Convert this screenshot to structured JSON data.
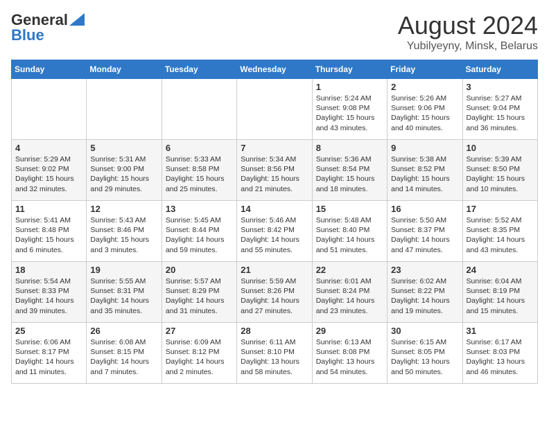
{
  "header": {
    "logo_general": "General",
    "logo_blue": "Blue",
    "title": "August 2024",
    "subtitle": "Yubilyeyny, Minsk, Belarus"
  },
  "days_of_week": [
    "Sunday",
    "Monday",
    "Tuesday",
    "Wednesday",
    "Thursday",
    "Friday",
    "Saturday"
  ],
  "weeks": [
    [
      {
        "day": "",
        "info": ""
      },
      {
        "day": "",
        "info": ""
      },
      {
        "day": "",
        "info": ""
      },
      {
        "day": "",
        "info": ""
      },
      {
        "day": "1",
        "info": "Sunrise: 5:24 AM\nSunset: 9:08 PM\nDaylight: 15 hours\nand 43 minutes."
      },
      {
        "day": "2",
        "info": "Sunrise: 5:26 AM\nSunset: 9:06 PM\nDaylight: 15 hours\nand 40 minutes."
      },
      {
        "day": "3",
        "info": "Sunrise: 5:27 AM\nSunset: 9:04 PM\nDaylight: 15 hours\nand 36 minutes."
      }
    ],
    [
      {
        "day": "4",
        "info": "Sunrise: 5:29 AM\nSunset: 9:02 PM\nDaylight: 15 hours\nand 32 minutes."
      },
      {
        "day": "5",
        "info": "Sunrise: 5:31 AM\nSunset: 9:00 PM\nDaylight: 15 hours\nand 29 minutes."
      },
      {
        "day": "6",
        "info": "Sunrise: 5:33 AM\nSunset: 8:58 PM\nDaylight: 15 hours\nand 25 minutes."
      },
      {
        "day": "7",
        "info": "Sunrise: 5:34 AM\nSunset: 8:56 PM\nDaylight: 15 hours\nand 21 minutes."
      },
      {
        "day": "8",
        "info": "Sunrise: 5:36 AM\nSunset: 8:54 PM\nDaylight: 15 hours\nand 18 minutes."
      },
      {
        "day": "9",
        "info": "Sunrise: 5:38 AM\nSunset: 8:52 PM\nDaylight: 15 hours\nand 14 minutes."
      },
      {
        "day": "10",
        "info": "Sunrise: 5:39 AM\nSunset: 8:50 PM\nDaylight: 15 hours\nand 10 minutes."
      }
    ],
    [
      {
        "day": "11",
        "info": "Sunrise: 5:41 AM\nSunset: 8:48 PM\nDaylight: 15 hours\nand 6 minutes."
      },
      {
        "day": "12",
        "info": "Sunrise: 5:43 AM\nSunset: 8:46 PM\nDaylight: 15 hours\nand 3 minutes."
      },
      {
        "day": "13",
        "info": "Sunrise: 5:45 AM\nSunset: 8:44 PM\nDaylight: 14 hours\nand 59 minutes."
      },
      {
        "day": "14",
        "info": "Sunrise: 5:46 AM\nSunset: 8:42 PM\nDaylight: 14 hours\nand 55 minutes."
      },
      {
        "day": "15",
        "info": "Sunrise: 5:48 AM\nSunset: 8:40 PM\nDaylight: 14 hours\nand 51 minutes."
      },
      {
        "day": "16",
        "info": "Sunrise: 5:50 AM\nSunset: 8:37 PM\nDaylight: 14 hours\nand 47 minutes."
      },
      {
        "day": "17",
        "info": "Sunrise: 5:52 AM\nSunset: 8:35 PM\nDaylight: 14 hours\nand 43 minutes."
      }
    ],
    [
      {
        "day": "18",
        "info": "Sunrise: 5:54 AM\nSunset: 8:33 PM\nDaylight: 14 hours\nand 39 minutes."
      },
      {
        "day": "19",
        "info": "Sunrise: 5:55 AM\nSunset: 8:31 PM\nDaylight: 14 hours\nand 35 minutes."
      },
      {
        "day": "20",
        "info": "Sunrise: 5:57 AM\nSunset: 8:29 PM\nDaylight: 14 hours\nand 31 minutes."
      },
      {
        "day": "21",
        "info": "Sunrise: 5:59 AM\nSunset: 8:26 PM\nDaylight: 14 hours\nand 27 minutes."
      },
      {
        "day": "22",
        "info": "Sunrise: 6:01 AM\nSunset: 8:24 PM\nDaylight: 14 hours\nand 23 minutes."
      },
      {
        "day": "23",
        "info": "Sunrise: 6:02 AM\nSunset: 8:22 PM\nDaylight: 14 hours\nand 19 minutes."
      },
      {
        "day": "24",
        "info": "Sunrise: 6:04 AM\nSunset: 8:19 PM\nDaylight: 14 hours\nand 15 minutes."
      }
    ],
    [
      {
        "day": "25",
        "info": "Sunrise: 6:06 AM\nSunset: 8:17 PM\nDaylight: 14 hours\nand 11 minutes."
      },
      {
        "day": "26",
        "info": "Sunrise: 6:08 AM\nSunset: 8:15 PM\nDaylight: 14 hours\nand 7 minutes."
      },
      {
        "day": "27",
        "info": "Sunrise: 6:09 AM\nSunset: 8:12 PM\nDaylight: 14 hours\nand 2 minutes."
      },
      {
        "day": "28",
        "info": "Sunrise: 6:11 AM\nSunset: 8:10 PM\nDaylight: 13 hours\nand 58 minutes."
      },
      {
        "day": "29",
        "info": "Sunrise: 6:13 AM\nSunset: 8:08 PM\nDaylight: 13 hours\nand 54 minutes."
      },
      {
        "day": "30",
        "info": "Sunrise: 6:15 AM\nSunset: 8:05 PM\nDaylight: 13 hours\nand 50 minutes."
      },
      {
        "day": "31",
        "info": "Sunrise: 6:17 AM\nSunset: 8:03 PM\nDaylight: 13 hours\nand 46 minutes."
      }
    ]
  ]
}
